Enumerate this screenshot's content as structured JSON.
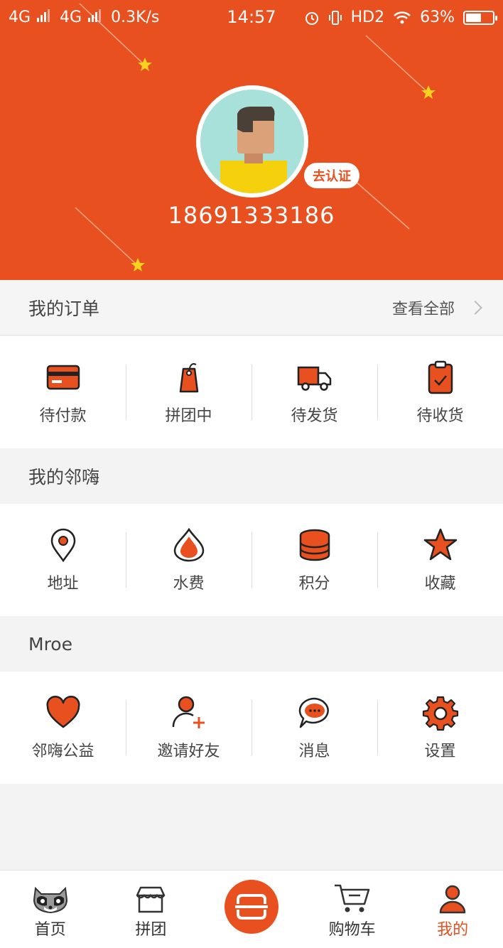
{
  "colors": {
    "accent": "#e8501f",
    "page_bg": "#f3f3f3"
  },
  "status_bar": {
    "network1": "4G",
    "network2": "4G",
    "speed": "0.3K/s",
    "time": "14:57",
    "hd": "HD2",
    "battery": "63%",
    "battery_level": 0.63
  },
  "profile": {
    "verify_label": "去认证",
    "phone": "18691333186"
  },
  "orders": {
    "title": "我的订单",
    "view_all": "查看全部",
    "items": [
      {
        "label": "待付款",
        "icon": "card-icon"
      },
      {
        "label": "拼团中",
        "icon": "tag-icon"
      },
      {
        "label": "待发货",
        "icon": "truck-icon"
      },
      {
        "label": "待收货",
        "icon": "clipboard-check-icon"
      }
    ]
  },
  "linhai": {
    "title": "我的邻嗨",
    "items": [
      {
        "label": "地址",
        "icon": "location-pin-icon"
      },
      {
        "label": "水费",
        "icon": "water-drop-icon"
      },
      {
        "label": "积分",
        "icon": "coin-stack-icon"
      },
      {
        "label": "收藏",
        "icon": "star-icon"
      }
    ]
  },
  "more": {
    "title": "Mroe",
    "items": [
      {
        "label": "邻嗨公益",
        "icon": "heart-icon"
      },
      {
        "label": "邀请好友",
        "icon": "add-user-icon"
      },
      {
        "label": "消息",
        "icon": "chat-bubble-icon"
      },
      {
        "label": "设置",
        "icon": "gear-icon"
      }
    ]
  },
  "bottom_nav": {
    "items": [
      {
        "label": "首页",
        "icon": "raccoon-icon"
      },
      {
        "label": "拼团",
        "icon": "shop-icon"
      },
      {
        "label": "",
        "icon": "scan-icon"
      },
      {
        "label": "购物车",
        "icon": "cart-icon"
      },
      {
        "label": "我的",
        "icon": "person-icon"
      }
    ],
    "active_index": 4
  }
}
